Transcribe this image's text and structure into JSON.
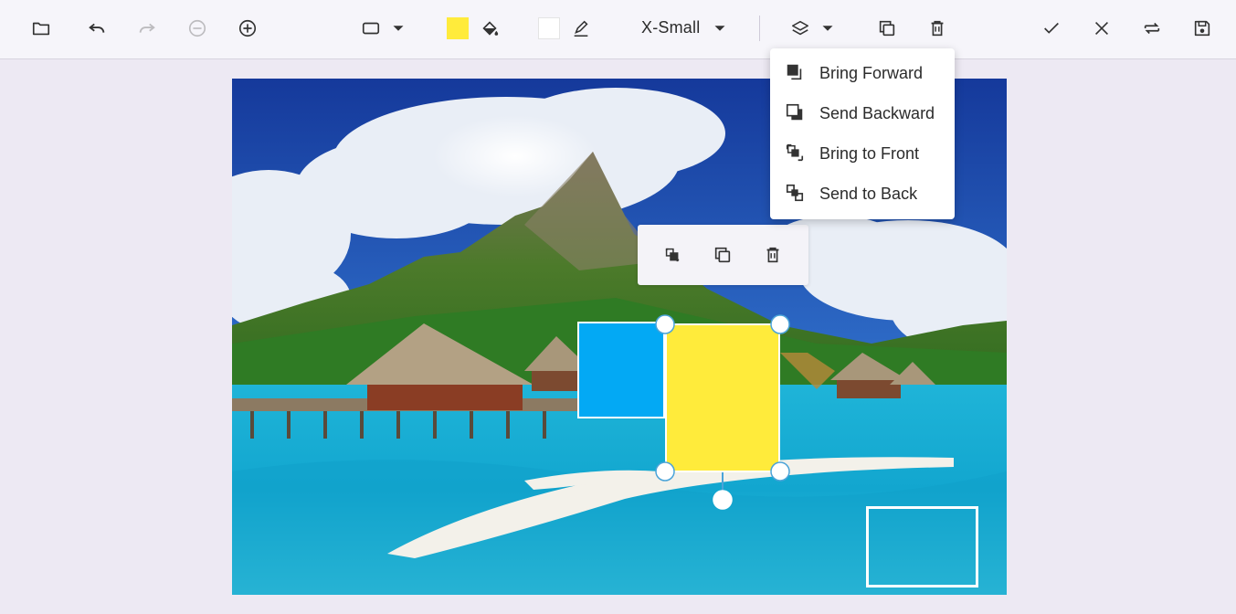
{
  "toolbar": {
    "icons": [
      "folder-open-icon",
      "undo-icon",
      "redo-icon",
      "zoom-out-icon",
      "zoom-in-icon",
      "rectangle-shape-icon",
      "fill-icon",
      "stroke-pen-icon",
      "layers-icon",
      "duplicate-icon",
      "delete-icon",
      "confirm-check-icon",
      "cancel-close-icon",
      "reset-icon",
      "save-icon"
    ],
    "fill_color": "#ffeb3b",
    "stroke_color": "#ffffff",
    "stroke_size": "X-Small"
  },
  "layer_menu": {
    "items": [
      {
        "label": "Bring Forward",
        "icon": "bring-forward-icon"
      },
      {
        "label": "Send Backward",
        "icon": "send-backward-icon"
      },
      {
        "label": "Bring to Front",
        "icon": "bring-to-front-icon"
      },
      {
        "label": "Send to Back",
        "icon": "send-to-back-icon"
      }
    ]
  },
  "quick_toolbar": {
    "icons": [
      "layer-order-icon",
      "duplicate-icon",
      "delete-icon"
    ]
  },
  "shapes": {
    "blue_fill": "#03a9f4",
    "yellow_fill": "#ffeb3b"
  }
}
